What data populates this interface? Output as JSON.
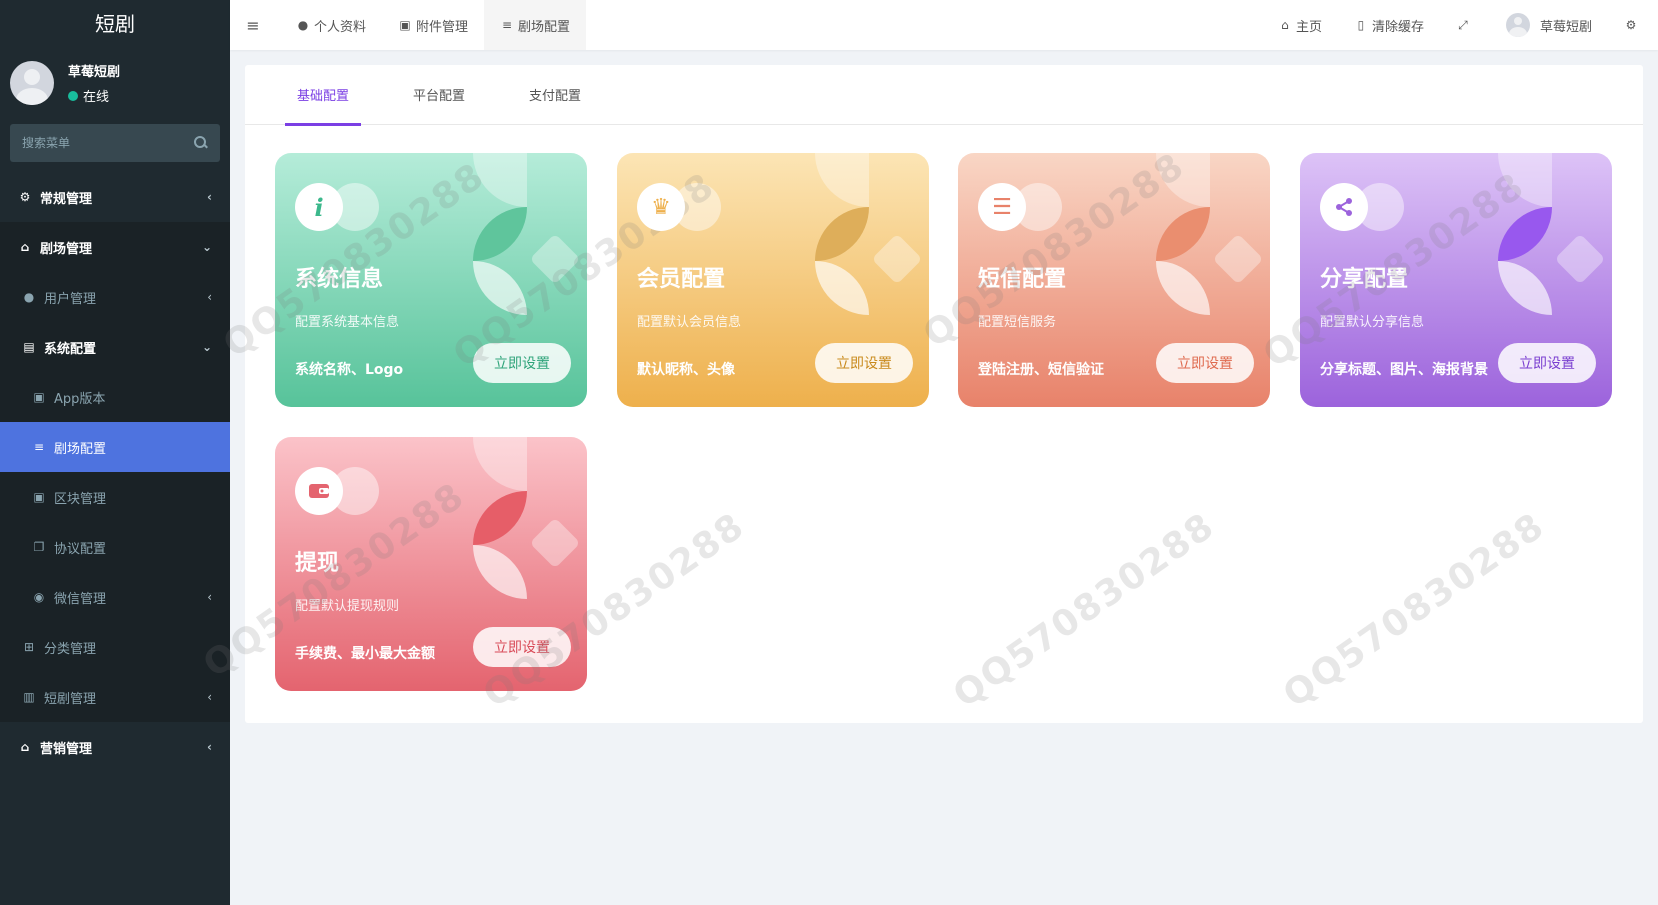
{
  "sidebar": {
    "brand": "短剧",
    "user": {
      "name": "草莓短剧",
      "status": "在线"
    },
    "search_placeholder": "搜索菜单",
    "items": [
      {
        "label": "常规管理",
        "icon": "cogs-icon"
      },
      {
        "label": "剧场管理",
        "icon": "home-icon"
      },
      {
        "label": "用户管理",
        "icon": "user-icon"
      },
      {
        "label": "系统配置",
        "icon": "file-icon"
      },
      {
        "label": "App版本",
        "icon": "image-icon"
      },
      {
        "label": "剧场配置",
        "icon": "sliders-icon"
      },
      {
        "label": "区块管理",
        "icon": "image-icon"
      },
      {
        "label": "协议配置",
        "icon": "copy-icon"
      },
      {
        "label": "微信管理",
        "icon": "wechat-icon"
      },
      {
        "label": "分类管理",
        "icon": "sitemap-icon"
      },
      {
        "label": "短剧管理",
        "icon": "shopping-bag-icon"
      },
      {
        "label": "营销管理",
        "icon": "home-icon"
      }
    ]
  },
  "header": {
    "tabs": [
      {
        "label": "个人资料",
        "icon": "user-icon"
      },
      {
        "label": "附件管理",
        "icon": "file-image-icon"
      },
      {
        "label": "剧场配置",
        "icon": "sliders-icon"
      }
    ],
    "home": "主页",
    "clear_cache": "清除缓存",
    "username": "草莓短剧"
  },
  "content": {
    "tabs": [
      "基础配置",
      "平台配置",
      "支付配置"
    ],
    "cards": [
      {
        "title": "系统信息",
        "desc": "配置系统基本信息",
        "features": "系统名称、Logo",
        "button": "立即设置",
        "icon": "info-icon"
      },
      {
        "title": "会员配置",
        "desc": "配置默认会员信息",
        "features": "默认昵称、头像",
        "button": "立即设置",
        "icon": "crown-icon"
      },
      {
        "title": "短信配置",
        "desc": "配置短信服务",
        "features": "登陆注册、短信验证",
        "button": "立即设置",
        "icon": "database-icon"
      },
      {
        "title": "分享配置",
        "desc": "配置默认分享信息",
        "features": "分享标题、图片、海报背景",
        "button": "立即设置",
        "icon": "share-icon"
      },
      {
        "title": "提现",
        "desc": "配置默认提现规则",
        "features": "手续费、最小最大金额",
        "button": "立即设置",
        "icon": "wallet-icon"
      }
    ]
  },
  "watermark": "QQ570830288",
  "colors": {
    "accent": "#7b3fe4",
    "active_menu": "#4e73df",
    "sidebar": "#1f2a30"
  }
}
